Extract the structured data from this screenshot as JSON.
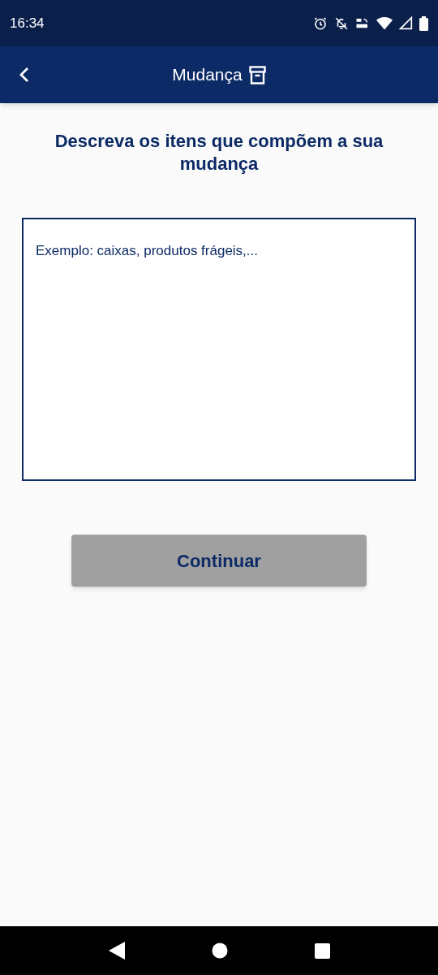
{
  "status_bar": {
    "time": "16:34"
  },
  "app_bar": {
    "title": "Mudança"
  },
  "heading": "Descreva os itens que compõem a sua mudança",
  "description_field": {
    "placeholder": "Exemplo: caixas, produtos frágeis,..."
  },
  "continue_button": {
    "label": "Continuar",
    "disabled": true
  }
}
